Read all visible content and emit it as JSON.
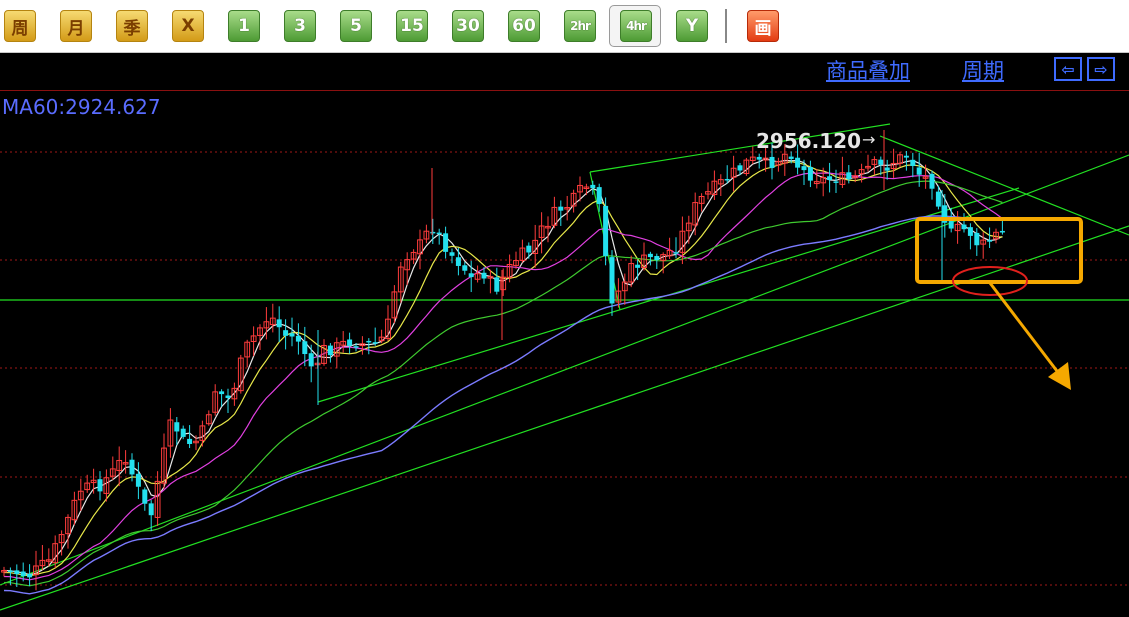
{
  "toolbar": {
    "buttons": [
      {
        "label": "周",
        "style": "yellow"
      },
      {
        "label": "月",
        "style": "yellow"
      },
      {
        "label": "季",
        "style": "yellow"
      },
      {
        "label": "X",
        "style": "yellow"
      },
      {
        "label": "1",
        "style": "green"
      },
      {
        "label": "3",
        "style": "green"
      },
      {
        "label": "5",
        "style": "green"
      },
      {
        "label": "15",
        "style": "green"
      },
      {
        "label": "30",
        "style": "green"
      },
      {
        "label": "60",
        "style": "green"
      },
      {
        "label": "2hr",
        "style": "green"
      },
      {
        "label": "4hr",
        "style": "green",
        "active": true
      },
      {
        "label": "Y",
        "style": "green"
      },
      {
        "label": "画",
        "style": "red"
      }
    ]
  },
  "header": {
    "overlay_link": "商品叠加",
    "period_link": "周期",
    "nav_left": "⇦",
    "nav_right": "⇨"
  },
  "indicator": {
    "ma60_label": "MA60:2924.627"
  },
  "annotation": {
    "high_label": "2956.120"
  },
  "colors": {
    "background": "#000000",
    "up_candle": "#ff3d3d",
    "down_candle": "#24e0ee",
    "ma_white": "#e8e8e8",
    "ma_yellow": "#e8e84a",
    "ma_magenta": "#e040e0",
    "ma_green": "#3fca2f",
    "ma60": "#7b7bff",
    "trendline": "#22e022",
    "highlight_box": "#f5a800",
    "ellipse": "#e0201c"
  },
  "chart_data": {
    "type": "candlestick",
    "high_value": 2956.12,
    "series": [
      {
        "name": "MA60",
        "last_value": 2924.627
      }
    ]
  }
}
